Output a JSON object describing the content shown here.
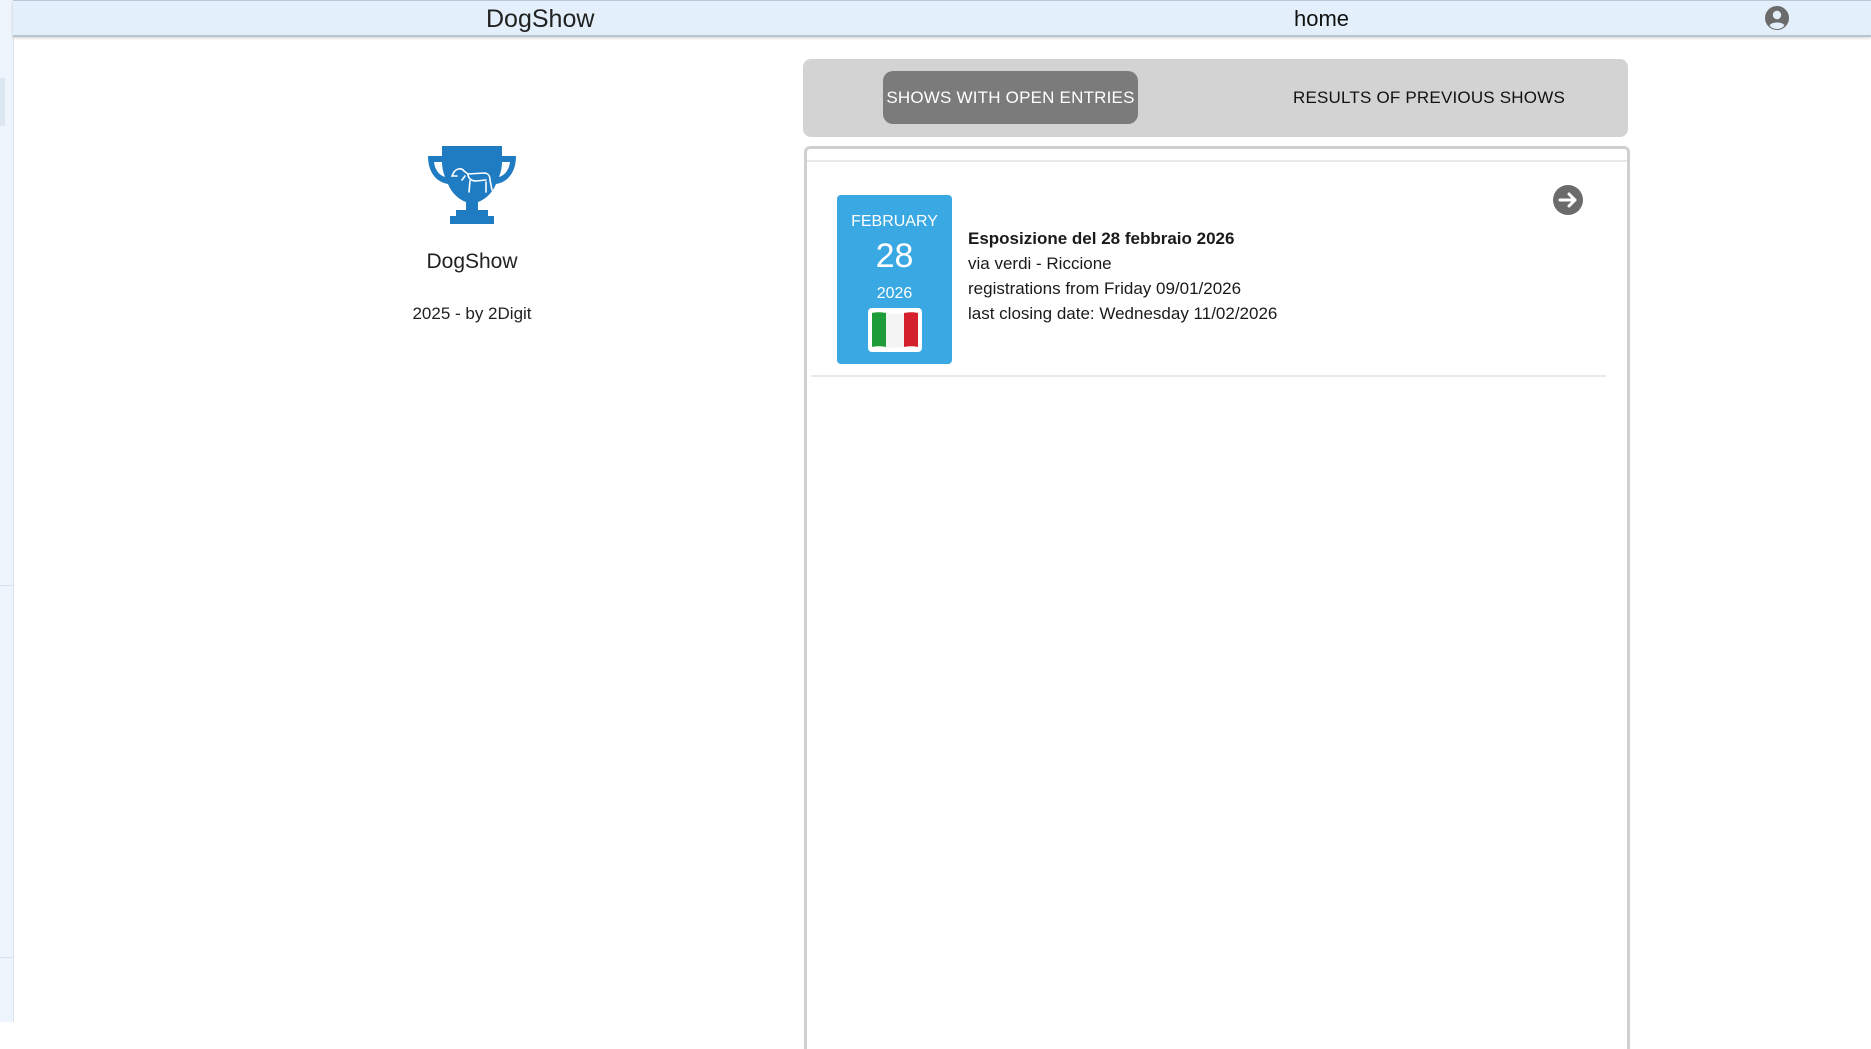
{
  "header": {
    "app_title": "DogShow",
    "nav_home": "home",
    "account_icon": "account-circle-icon"
  },
  "brand": {
    "logo_icon": "trophy-dog-icon",
    "name": "DogShow",
    "credit": "2025 - by 2Digit"
  },
  "tabs": [
    {
      "label": "SHOWS WITH OPEN ENTRIES",
      "active": true
    },
    {
      "label": "RESULTS OF PREVIOUS SHOWS",
      "active": false
    }
  ],
  "shows": [
    {
      "month": "FEBRUARY",
      "day": "28",
      "year": "2026",
      "flag_icon": "italy-flag-icon",
      "title": "Esposizione del 28 febbraio 2026",
      "location": "via verdi - Riccione",
      "registrations": "registrations from Friday 09/01/2026",
      "closing": "last closing date: Wednesday 11/02/2026",
      "action_icon": "arrow-right-circle-icon"
    }
  ],
  "colors": {
    "topbar": "#e3f0fb",
    "accent_blue": "#3aa9e3",
    "logo_blue": "#1f7bc2",
    "tab_active": "#7b7b7b",
    "tab_bg": "#d3d3d3"
  }
}
